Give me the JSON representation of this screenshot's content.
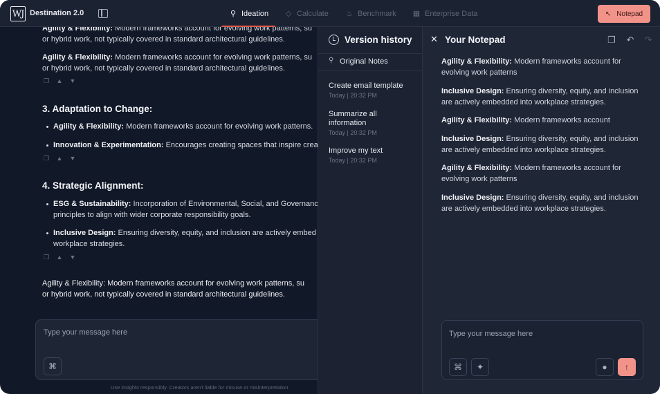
{
  "app": {
    "logo_text": "WJ",
    "title": "Destination 2.0"
  },
  "nav": {
    "tabs": [
      {
        "label": "Ideation",
        "icon": "bulb-icon",
        "active": true
      },
      {
        "label": "Calculate",
        "icon": "diamond-icon",
        "active": false
      },
      {
        "label": "Benchmark",
        "icon": "flame-icon",
        "active": false
      },
      {
        "label": "Enterprise Data",
        "icon": "scan-icon",
        "active": false
      }
    ],
    "notepad_button": "Notepad"
  },
  "chat": {
    "top_para": {
      "bold": "Agility & Flexibility:",
      "line1": " Modern frameworks account for evolving work patterns, su",
      "line2": "or hybrid work, not typically covered in standard architectural guidelines."
    },
    "para2": {
      "bold": "Agility & Flexibility:",
      "line1": " Modern frameworks account for evolving work patterns, su",
      "line2": "or hybrid work, not typically covered in standard architectural guidelines."
    },
    "section3": {
      "title": "3. Adaptation to Change:",
      "bullets": [
        {
          "bold": "Agility & Flexibility:",
          "text": " Modern frameworks account for evolving work patterns."
        },
        {
          "bold": "Innovation & Experimentation:",
          "text": " Encourages creating spaces that inspire crea"
        }
      ]
    },
    "section4": {
      "title": "4. Strategic Alignment:",
      "bullets": [
        {
          "bold": "ESG & Sustainability:",
          "text": " Incorporation of Environmental, Social, and Governanc",
          "line2": "principles to align with wider corporate responsibility goals."
        },
        {
          "bold": "Inclusive Design:",
          "text": " Ensuring diversity, equity, and inclusion are actively embed",
          "line2": "workplace strategies."
        }
      ]
    },
    "bottom_para": {
      "line1": "Agility & Flexibility: Modern frameworks account for evolving work patterns, su",
      "line2": "or hybrid work, not typically covered in standard architectural guidelines."
    },
    "input_placeholder": "Type your message here",
    "disclaimer": "Use insights responsibly. Creators aren't liable for misuse or misinterpretation"
  },
  "version_history": {
    "title": "Version history",
    "original": "Original Notes",
    "items": [
      {
        "name": "Create email template",
        "time": "Today | 20:32 PM"
      },
      {
        "name": "Summarize all information",
        "time": "Today | 20:32 PM"
      },
      {
        "name": "Improve my text",
        "time": "Today | 20:32 PM"
      }
    ]
  },
  "notepad": {
    "title": "Your Notepad",
    "paras": [
      {
        "bold": "Agility & Flexibility:",
        "text": " Modern frameworks account for evolving work patterns"
      },
      {
        "bold": "Inclusive Design:",
        "text": " Ensuring diversity, equity, and inclusion are actively embedded into workplace strategies."
      },
      {
        "bold": "Agility & Flexibility:",
        "text": " Modern frameworks account"
      },
      {
        "bold": "Inclusive Design:",
        "text": " Ensuring diversity, equity, and inclusion are actively embedded into workplace strategies."
      },
      {
        "bold": "Agility & Flexibility:",
        "text": " Modern frameworks account for evolving work patterns"
      },
      {
        "bold": "Inclusive Design:",
        "text": " Ensuring diversity, equity, and inclusion are actively embedded into workplace strategies."
      }
    ],
    "input_placeholder": "Type your message here"
  },
  "colors": {
    "accent": "#f2938a",
    "active_underline": "#e0584a",
    "background": "#111827",
    "panel": "#1f2636"
  }
}
